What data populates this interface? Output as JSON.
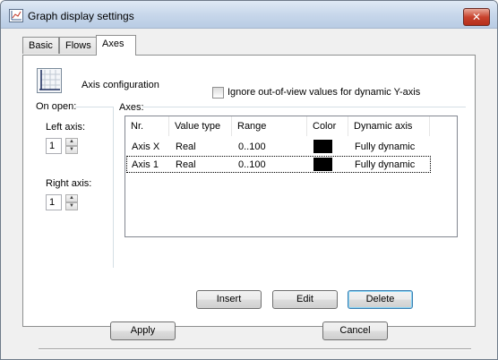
{
  "window": {
    "title": "Graph display settings",
    "close_glyph": "✕"
  },
  "tabs": [
    {
      "label": "Basic"
    },
    {
      "label": "Flows"
    },
    {
      "label": "Axes"
    }
  ],
  "axes_tab": {
    "heading": "Axis configuration",
    "ignore_checkbox": {
      "label": "Ignore out-of-view values for dynamic Y-axis",
      "checked": false
    },
    "on_open_label": "On open:",
    "left_axis": {
      "label": "Left axis:",
      "value": "1"
    },
    "right_axis": {
      "label": "Right axis:",
      "value": "1"
    },
    "axes_group_label": "Axes:",
    "columns": [
      "Nr.",
      "Value type",
      "Range",
      "Color",
      "Dynamic axis"
    ],
    "rows": [
      {
        "nr": "Axis X",
        "value_type": "Real",
        "range": "0..100",
        "color": "#000000",
        "dynamic_axis": "Fully dynamic"
      },
      {
        "nr": "Axis 1",
        "value_type": "Real",
        "range": "0..100",
        "color": "#000000",
        "dynamic_axis": "Fully dynamic"
      }
    ],
    "buttons": {
      "insert": "Insert",
      "edit": "Edit",
      "delete": "Delete"
    }
  },
  "footer": {
    "apply": "Apply",
    "cancel": "Cancel"
  }
}
